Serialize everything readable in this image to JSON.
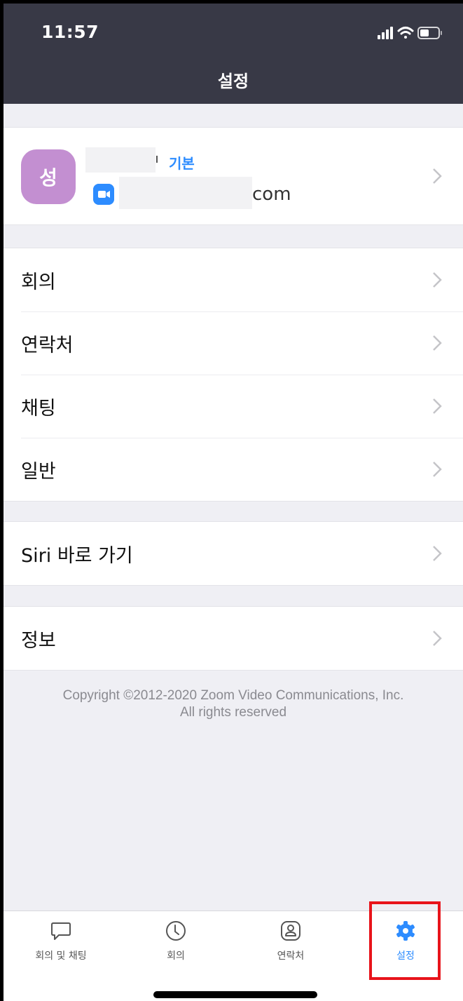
{
  "status_bar": {
    "time": "11:57"
  },
  "header": {
    "title": "설정"
  },
  "profile": {
    "avatar_initial": "성",
    "plan_label": "기본",
    "email_tail": "com",
    "avatar_color": "#c38fd1",
    "zoom_icon": "zoom-video-icon"
  },
  "menu": {
    "meetings": "회의",
    "contacts": "연락처",
    "chat": "채팅",
    "general": "일반",
    "siri": "Siri 바로 가기",
    "about": "정보"
  },
  "copyright": {
    "line1": "Copyright ©2012-2020 Zoom Video Communications, Inc.",
    "line2": "All rights reserved"
  },
  "tabs": [
    {
      "label": "회의 및 채팅",
      "icon": "chat-bubble-icon"
    },
    {
      "label": "회의",
      "icon": "clock-icon"
    },
    {
      "label": "연락처",
      "icon": "contact-icon"
    },
    {
      "label": "설정",
      "icon": "gear-icon"
    }
  ],
  "colors": {
    "accent": "#2d8cff",
    "header": "#383946",
    "highlight": "#e8141b"
  }
}
